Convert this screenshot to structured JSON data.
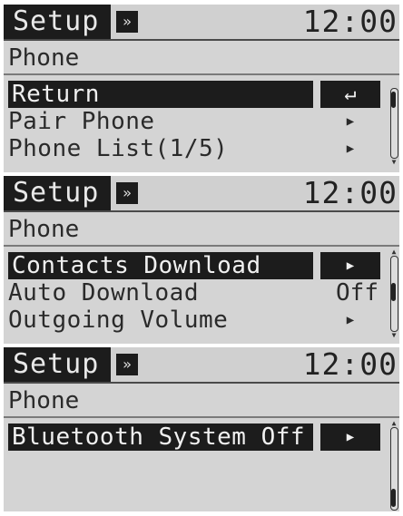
{
  "screens": [
    {
      "header": {
        "title": "Setup",
        "bt_icon": "bluetooth-icon",
        "bt_glyph": "»",
        "clock": "12:00"
      },
      "submenu": "Phone",
      "rows": [
        {
          "label": "Return",
          "selected": true,
          "action_icon": "return-arrow-icon",
          "action_glyph": "↵"
        },
        {
          "label": "Pair Phone",
          "selected": false,
          "action_icon": "arrow-right-icon",
          "action_glyph": "▶"
        },
        {
          "label": "Phone List(1/5)",
          "selected": false,
          "action_icon": "arrow-right-icon",
          "action_glyph": "▶"
        }
      ],
      "scroll": {
        "up_arrow": false,
        "down_arrow": true,
        "position": "top"
      }
    },
    {
      "header": {
        "title": "Setup",
        "bt_icon": "bluetooth-icon",
        "bt_glyph": "»",
        "clock": "12:00"
      },
      "submenu": "Phone",
      "rows": [
        {
          "label": "Contacts Download",
          "selected": true,
          "action_icon": "arrow-right-icon",
          "action_glyph": "▶"
        },
        {
          "label": "Auto Download",
          "selected": false,
          "value": "Off"
        },
        {
          "label": "Outgoing Volume",
          "selected": false,
          "action_icon": "arrow-right-icon",
          "action_glyph": "▶"
        }
      ],
      "scroll": {
        "up_arrow": true,
        "down_arrow": true,
        "position": "middle"
      }
    },
    {
      "header": {
        "title": "Setup",
        "bt_icon": "bluetooth-icon",
        "bt_glyph": "»",
        "clock": "12:00"
      },
      "submenu": "Phone",
      "rows": [
        {
          "label": "Bluetooth System Off",
          "selected": true,
          "action_icon": "arrow-right-icon",
          "action_glyph": "▶"
        }
      ],
      "scroll": {
        "up_arrow": true,
        "down_arrow": false,
        "position": "bottom"
      }
    }
  ]
}
